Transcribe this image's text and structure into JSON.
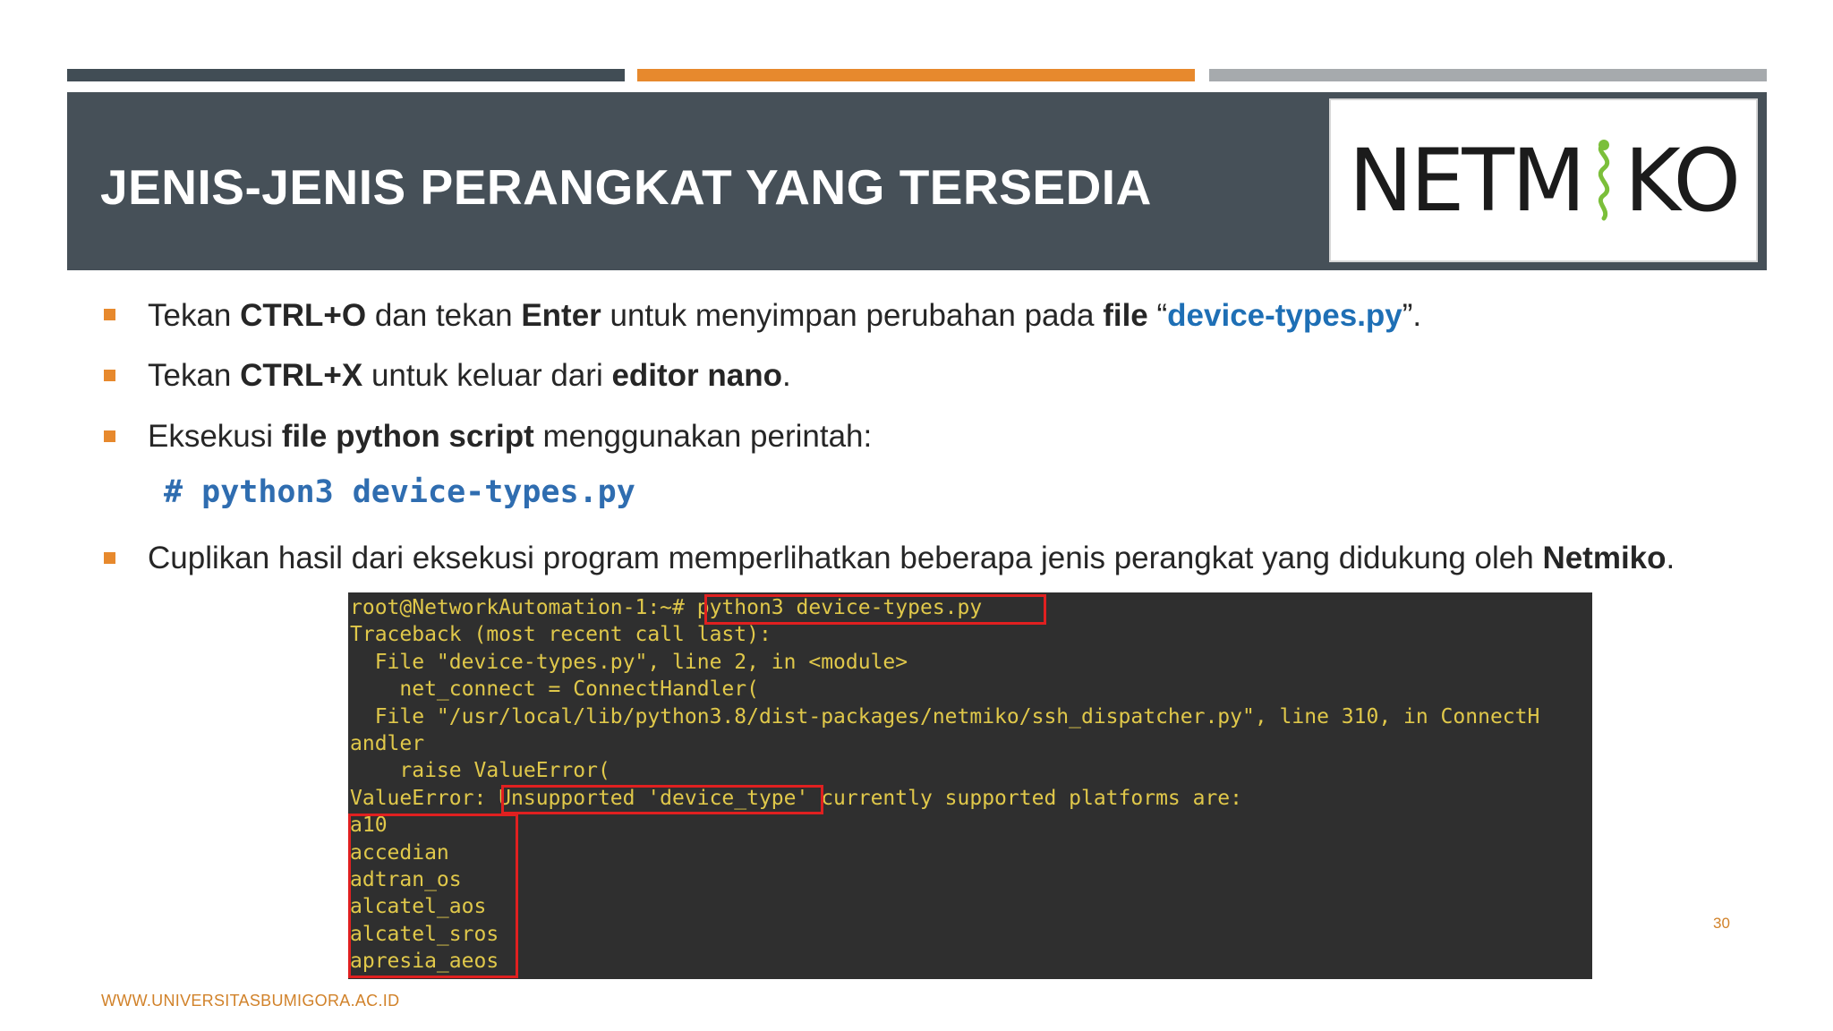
{
  "slide": {
    "title": "JENIS-JENIS PERANGKAT YANG TERSEDIA",
    "logo_text_left": "NETM",
    "logo_text_right": "KO",
    "bullets": [
      {
        "parts": [
          {
            "text": "Tekan ",
            "style": "normal"
          },
          {
            "text": "CTRL+O",
            "style": "bold"
          },
          {
            "text": " dan tekan ",
            "style": "normal"
          },
          {
            "text": "Enter",
            "style": "bold"
          },
          {
            "text": " untuk menyimpan perubahan pada ",
            "style": "normal"
          },
          {
            "text": "file",
            "style": "bold"
          },
          {
            "text": " “",
            "style": "normal"
          },
          {
            "text": "device-types.py",
            "style": "link"
          },
          {
            "text": "”.",
            "style": "normal"
          }
        ]
      },
      {
        "parts": [
          {
            "text": "Tekan ",
            "style": "normal"
          },
          {
            "text": "CTRL+X",
            "style": "bold"
          },
          {
            "text": " untuk keluar dari ",
            "style": "normal"
          },
          {
            "text": "editor nano",
            "style": "bold"
          },
          {
            "text": ".",
            "style": "normal"
          }
        ]
      },
      {
        "parts": [
          {
            "text": "Eksekusi ",
            "style": "normal"
          },
          {
            "text": "file python script",
            "style": "bold"
          },
          {
            "text": " menggunakan perintah:",
            "style": "normal"
          }
        ]
      },
      {
        "parts": [
          {
            "text": "Cuplikan hasil dari eksekusi program memperlihatkan beberapa jenis perangkat yang didukung oleh ",
            "style": "normal"
          },
          {
            "text": "Netmiko",
            "style": "bold"
          },
          {
            "text": ".",
            "style": "normal"
          }
        ]
      }
    ],
    "command": "# python3 device-types.py",
    "terminal_lines": [
      "root@NetworkAutomation-1:~# python3 device-types.py",
      "Traceback (most recent call last):",
      "  File \"device-types.py\", line 2, in <module>",
      "    net_connect = ConnectHandler(",
      "  File \"/usr/local/lib/python3.8/dist-packages/netmiko/ssh_dispatcher.py\", line 310, in ConnectH",
      "andler",
      "    raise ValueError(",
      "ValueError: Unsupported 'device_type' currently supported platforms are:",
      "a10",
      "accedian",
      "adtran_os",
      "alcatel_aos",
      "alcatel_sros",
      "apresia_aeos"
    ],
    "page_number": "30",
    "footer": "WWW.UNIVERSITASBUMIGORA.AC.ID"
  },
  "colors": {
    "accent_orange": "#e7892d",
    "title_band": "#465058",
    "link_blue": "#1e6fb5",
    "terminal_bg": "#2f2f2f",
    "terminal_text": "#e0c84a",
    "highlight_red": "#e02020"
  }
}
